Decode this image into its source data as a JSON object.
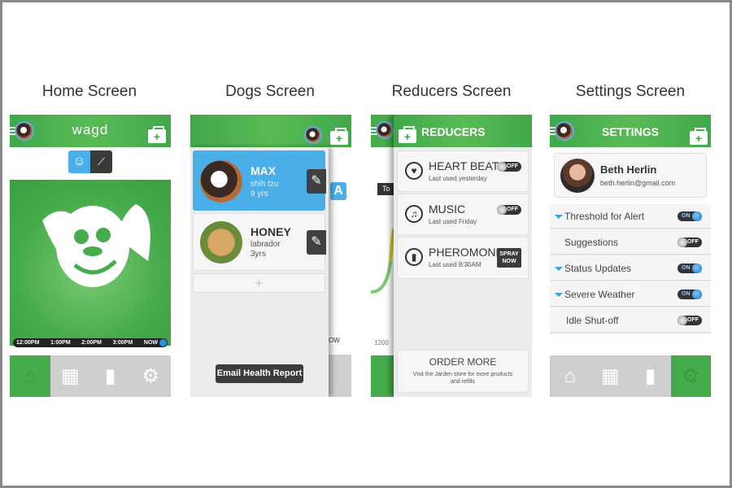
{
  "titles": [
    "Home Screen",
    "Dogs Screen",
    "Reducers Screen",
    "Settings Screen"
  ],
  "colors": {
    "brand_green": "#46ab4a",
    "accent_blue": "#4aaee8",
    "dark": "#404040"
  },
  "home": {
    "logo": "wagd",
    "view_toggle": [
      {
        "icon": "dog-face-icon",
        "active": true
      },
      {
        "icon": "line-chart-icon",
        "active": false
      }
    ],
    "timeline": [
      "12:00PM",
      "1:00PM",
      "2:00PM",
      "3:00PM",
      "NOW"
    ],
    "nav": [
      {
        "icon": "home-icon",
        "active": true
      },
      {
        "icon": "calendar-icon"
      },
      {
        "icon": "bar-chart-icon"
      },
      {
        "icon": "gear-icon"
      }
    ]
  },
  "dogs": {
    "items": [
      {
        "name": "MAX",
        "breed": "shih tzu",
        "age": "9 yrs",
        "selected": true
      },
      {
        "name": "HONEY",
        "breed": "labrador",
        "age": "3yrs",
        "selected": false
      }
    ],
    "add_icon": "plus-icon",
    "email_button": "Email Health Report",
    "behind_fragments": {
      "letter": "A",
      "time": "OW"
    }
  },
  "reducers": {
    "title": "REDUCERS",
    "items": [
      {
        "name": "HEART BEAT",
        "sub": "Last used yesterday",
        "icon": "heart-icon",
        "control": "toggle",
        "state": "OFF"
      },
      {
        "name": "MUSIC",
        "sub": "Last used Friday",
        "icon": "music-note-icon",
        "control": "toggle",
        "state": "OFF"
      },
      {
        "name": "PHEROMONE",
        "sub": "Last used 8:30AM",
        "icon": "spray-can-icon",
        "control": "button",
        "button": "SPRAY NOW"
      }
    ],
    "order_title": "ORDER MORE",
    "order_sub": "Visit the Jarden store for more products and refills",
    "behind_fragments": {
      "tab": "To",
      "time": "1200"
    }
  },
  "settings": {
    "title": "SETTINGS",
    "user": {
      "name": "Beth Herlin",
      "email": "beth.herlin@gmail.com"
    },
    "rows": [
      {
        "label": "Threshold for Alert",
        "expandable": true,
        "state": "ON"
      },
      {
        "label": "Suggestions",
        "expandable": false,
        "state": "OFF"
      },
      {
        "label": "Status Updates",
        "expandable": true,
        "state": "ON"
      },
      {
        "label": "Severe Weather",
        "expandable": true,
        "state": "ON"
      },
      {
        "label": "Idle Shut-off",
        "expandable": false,
        "state": "OFF"
      }
    ],
    "nav_active": "gear-icon"
  }
}
